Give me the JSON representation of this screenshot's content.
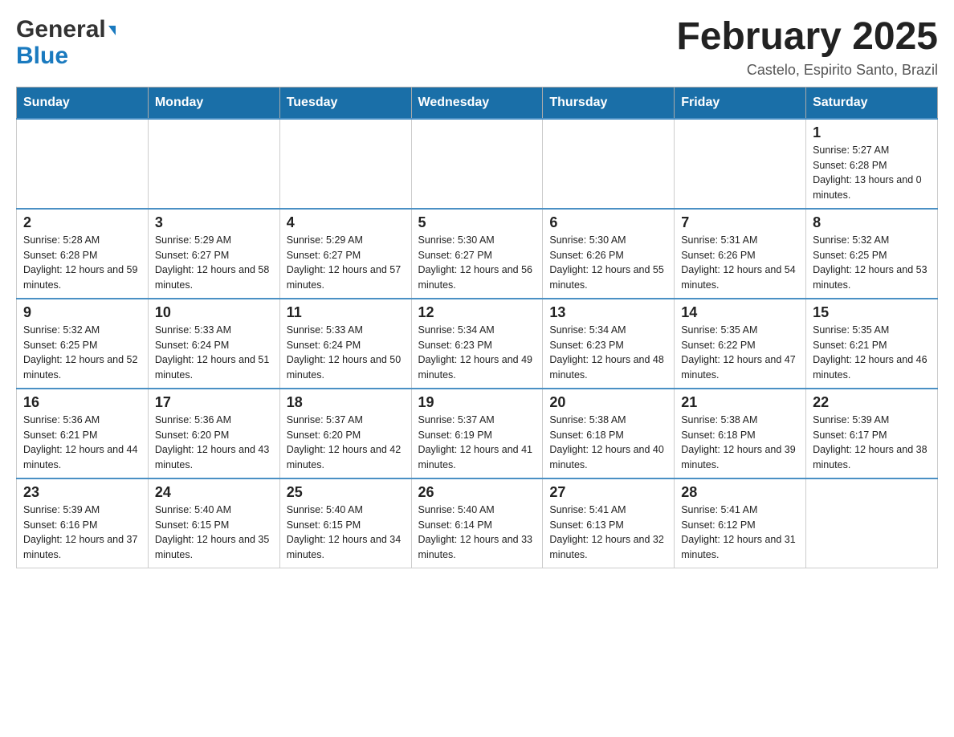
{
  "logo": {
    "general": "General",
    "blue": "Blue",
    "triangle": "▲"
  },
  "header": {
    "month_title": "February 2025",
    "location": "Castelo, Espirito Santo, Brazil"
  },
  "weekdays": [
    "Sunday",
    "Monday",
    "Tuesday",
    "Wednesday",
    "Thursday",
    "Friday",
    "Saturday"
  ],
  "weeks": [
    [
      {
        "day": "",
        "info": ""
      },
      {
        "day": "",
        "info": ""
      },
      {
        "day": "",
        "info": ""
      },
      {
        "day": "",
        "info": ""
      },
      {
        "day": "",
        "info": ""
      },
      {
        "day": "",
        "info": ""
      },
      {
        "day": "1",
        "info": "Sunrise: 5:27 AM\nSunset: 6:28 PM\nDaylight: 13 hours and 0 minutes."
      }
    ],
    [
      {
        "day": "2",
        "info": "Sunrise: 5:28 AM\nSunset: 6:28 PM\nDaylight: 12 hours and 59 minutes."
      },
      {
        "day": "3",
        "info": "Sunrise: 5:29 AM\nSunset: 6:27 PM\nDaylight: 12 hours and 58 minutes."
      },
      {
        "day": "4",
        "info": "Sunrise: 5:29 AM\nSunset: 6:27 PM\nDaylight: 12 hours and 57 minutes."
      },
      {
        "day": "5",
        "info": "Sunrise: 5:30 AM\nSunset: 6:27 PM\nDaylight: 12 hours and 56 minutes."
      },
      {
        "day": "6",
        "info": "Sunrise: 5:30 AM\nSunset: 6:26 PM\nDaylight: 12 hours and 55 minutes."
      },
      {
        "day": "7",
        "info": "Sunrise: 5:31 AM\nSunset: 6:26 PM\nDaylight: 12 hours and 54 minutes."
      },
      {
        "day": "8",
        "info": "Sunrise: 5:32 AM\nSunset: 6:25 PM\nDaylight: 12 hours and 53 minutes."
      }
    ],
    [
      {
        "day": "9",
        "info": "Sunrise: 5:32 AM\nSunset: 6:25 PM\nDaylight: 12 hours and 52 minutes."
      },
      {
        "day": "10",
        "info": "Sunrise: 5:33 AM\nSunset: 6:24 PM\nDaylight: 12 hours and 51 minutes."
      },
      {
        "day": "11",
        "info": "Sunrise: 5:33 AM\nSunset: 6:24 PM\nDaylight: 12 hours and 50 minutes."
      },
      {
        "day": "12",
        "info": "Sunrise: 5:34 AM\nSunset: 6:23 PM\nDaylight: 12 hours and 49 minutes."
      },
      {
        "day": "13",
        "info": "Sunrise: 5:34 AM\nSunset: 6:23 PM\nDaylight: 12 hours and 48 minutes."
      },
      {
        "day": "14",
        "info": "Sunrise: 5:35 AM\nSunset: 6:22 PM\nDaylight: 12 hours and 47 minutes."
      },
      {
        "day": "15",
        "info": "Sunrise: 5:35 AM\nSunset: 6:21 PM\nDaylight: 12 hours and 46 minutes."
      }
    ],
    [
      {
        "day": "16",
        "info": "Sunrise: 5:36 AM\nSunset: 6:21 PM\nDaylight: 12 hours and 44 minutes."
      },
      {
        "day": "17",
        "info": "Sunrise: 5:36 AM\nSunset: 6:20 PM\nDaylight: 12 hours and 43 minutes."
      },
      {
        "day": "18",
        "info": "Sunrise: 5:37 AM\nSunset: 6:20 PM\nDaylight: 12 hours and 42 minutes."
      },
      {
        "day": "19",
        "info": "Sunrise: 5:37 AM\nSunset: 6:19 PM\nDaylight: 12 hours and 41 minutes."
      },
      {
        "day": "20",
        "info": "Sunrise: 5:38 AM\nSunset: 6:18 PM\nDaylight: 12 hours and 40 minutes."
      },
      {
        "day": "21",
        "info": "Sunrise: 5:38 AM\nSunset: 6:18 PM\nDaylight: 12 hours and 39 minutes."
      },
      {
        "day": "22",
        "info": "Sunrise: 5:39 AM\nSunset: 6:17 PM\nDaylight: 12 hours and 38 minutes."
      }
    ],
    [
      {
        "day": "23",
        "info": "Sunrise: 5:39 AM\nSunset: 6:16 PM\nDaylight: 12 hours and 37 minutes."
      },
      {
        "day": "24",
        "info": "Sunrise: 5:40 AM\nSunset: 6:15 PM\nDaylight: 12 hours and 35 minutes."
      },
      {
        "day": "25",
        "info": "Sunrise: 5:40 AM\nSunset: 6:15 PM\nDaylight: 12 hours and 34 minutes."
      },
      {
        "day": "26",
        "info": "Sunrise: 5:40 AM\nSunset: 6:14 PM\nDaylight: 12 hours and 33 minutes."
      },
      {
        "day": "27",
        "info": "Sunrise: 5:41 AM\nSunset: 6:13 PM\nDaylight: 12 hours and 32 minutes."
      },
      {
        "day": "28",
        "info": "Sunrise: 5:41 AM\nSunset: 6:12 PM\nDaylight: 12 hours and 31 minutes."
      },
      {
        "day": "",
        "info": ""
      }
    ]
  ]
}
